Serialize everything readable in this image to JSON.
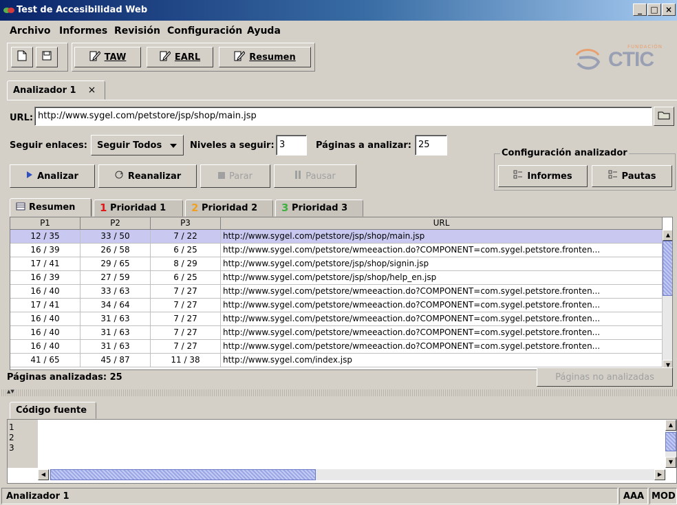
{
  "window": {
    "title": "Test de Accesibilidad Web",
    "controls": [
      "_",
      "□",
      "×"
    ]
  },
  "menu": [
    "Archivo",
    "Informes",
    "Revisión",
    "Configuración",
    "Ayuda"
  ],
  "toolbar": {
    "taw_label": "TAW",
    "earl_label": "EARL",
    "resumen_label": "Resumen",
    "logo": "CTIC",
    "logo_small": "FUNDACIÓN"
  },
  "doc_tab": {
    "label": "Analizador 1",
    "close": "×"
  },
  "url": {
    "label": "URL:",
    "value": "http://www.sygel.com/petstore/jsp/shop/main.jsp"
  },
  "options": {
    "follow_label": "Seguir enlaces:",
    "follow_value": "Seguir Todos",
    "levels_label": "Niveles a seguir:",
    "levels_value": "3",
    "pages_label": "Páginas a analizar:",
    "pages_value": "25"
  },
  "actions": {
    "analizar": "Analizar",
    "reanalizar": "Reanalizar",
    "parar": "Parar",
    "pausar": "Pausar"
  },
  "config": {
    "title": "Configuración analizador",
    "informes": "Informes",
    "pautas": "Pautas"
  },
  "result_tabs": [
    {
      "label": "Resumen"
    },
    {
      "label": "Prioridad 1",
      "number": "1",
      "color": "#e01818"
    },
    {
      "label": "Prioridad 2",
      "number": "2",
      "color": "#f0a020"
    },
    {
      "label": "Prioridad 3",
      "number": "3",
      "color": "#40b040"
    }
  ],
  "table": {
    "columns": [
      "P1",
      "P2",
      "P3",
      "URL"
    ],
    "rows": [
      [
        "12 / 35",
        "33 / 50",
        "7 / 22",
        "http://www.sygel.com/petstore/jsp/shop/main.jsp"
      ],
      [
        "16 / 39",
        "26 / 58",
        "6 / 25",
        "http://www.sygel.com/petstore/wmeeaction.do?COMPONENT=com.sygel.petstore.fronten..."
      ],
      [
        "17 / 41",
        "29 / 65",
        "8 / 29",
        "http://www.sygel.com/petstore/jsp/shop/signin.jsp"
      ],
      [
        "16 / 39",
        "27 / 59",
        "6 / 25",
        "http://www.sygel.com/petstore/jsp/shop/help_en.jsp"
      ],
      [
        "16 / 40",
        "33 / 63",
        "7 / 27",
        "http://www.sygel.com/petstore/wmeeaction.do?COMPONENT=com.sygel.petstore.fronten..."
      ],
      [
        "17 / 41",
        "34 / 64",
        "7 / 27",
        "http://www.sygel.com/petstore/wmeeaction.do?COMPONENT=com.sygel.petstore.fronten..."
      ],
      [
        "16 / 40",
        "31 / 63",
        "7 / 27",
        "http://www.sygel.com/petstore/wmeeaction.do?COMPONENT=com.sygel.petstore.fronten..."
      ],
      [
        "16 / 40",
        "31 / 63",
        "7 / 27",
        "http://www.sygel.com/petstore/wmeeaction.do?COMPONENT=com.sygel.petstore.fronten..."
      ],
      [
        "16 / 40",
        "31 / 63",
        "7 / 27",
        "http://www.sygel.com/petstore/wmeeaction.do?COMPONENT=com.sygel.petstore.fronten..."
      ],
      [
        "41 / 65",
        "45 / 87",
        "11 / 38",
        "http://www.sygel.com/index.jsp"
      ]
    ]
  },
  "summary": {
    "analyzed": "Páginas analizadas: 25",
    "not_analyzed_button": "Páginas no analizadas"
  },
  "source": {
    "tab": "Código fuente",
    "lines": [
      "1",
      "2",
      "3"
    ]
  },
  "status": {
    "left": "Analizador 1",
    "aaa": "AAA",
    "mod": "MOD"
  },
  "colors": {
    "selection": "#c8c8f0",
    "titlebar": "#0a246a",
    "logo": "#9aa0b4",
    "logo_accent": "#e8a070"
  },
  "icons": [
    "new-doc-icon",
    "save-icon",
    "edit-doc-icon",
    "play-icon",
    "reload-icon",
    "stop-icon",
    "pause-icon",
    "folder-icon",
    "list-icon",
    "table-icon",
    "dropdown-arrow-icon"
  ]
}
